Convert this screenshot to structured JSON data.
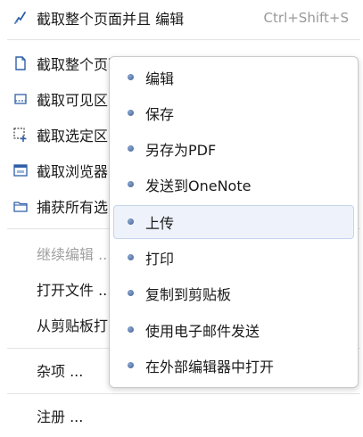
{
  "main_menu": {
    "items": [
      {
        "label": "截取整个页面并且 编辑",
        "shortcut": "Ctrl+Shift+S",
        "icon": "pencil-icon"
      },
      {
        "label": "截取整个页面并且",
        "icon": "page-icon"
      },
      {
        "label": "截取可见区",
        "icon": "visible-area-icon"
      },
      {
        "label": "截取选定区",
        "icon": "selection-icon"
      },
      {
        "label": "截取浏览器",
        "icon": "browser-window-icon"
      },
      {
        "label": "捕获所有选",
        "icon": "folder-icon"
      },
      {
        "label": "继续编辑 ..."
      },
      {
        "label": "打开文件 ..."
      },
      {
        "label": "从剪贴板打"
      },
      {
        "label": "杂项 ..."
      },
      {
        "label": "注册 ..."
      }
    ]
  },
  "submenu": {
    "items": [
      {
        "label": "编辑"
      },
      {
        "label": "保存"
      },
      {
        "label": "另存为PDF"
      },
      {
        "label": "发送到OneNote"
      },
      {
        "label": "上传"
      },
      {
        "label": "打印"
      },
      {
        "label": "复制到剪贴板"
      },
      {
        "label": "使用电子邮件发送"
      },
      {
        "label": "在外部编辑器中打开"
      }
    ]
  },
  "colors": {
    "bullet": "#4a6ea8",
    "icon_blue": "#2f5fa8",
    "hover_bg": "#eef3fb",
    "disabled_text": "#a0a0a0"
  }
}
